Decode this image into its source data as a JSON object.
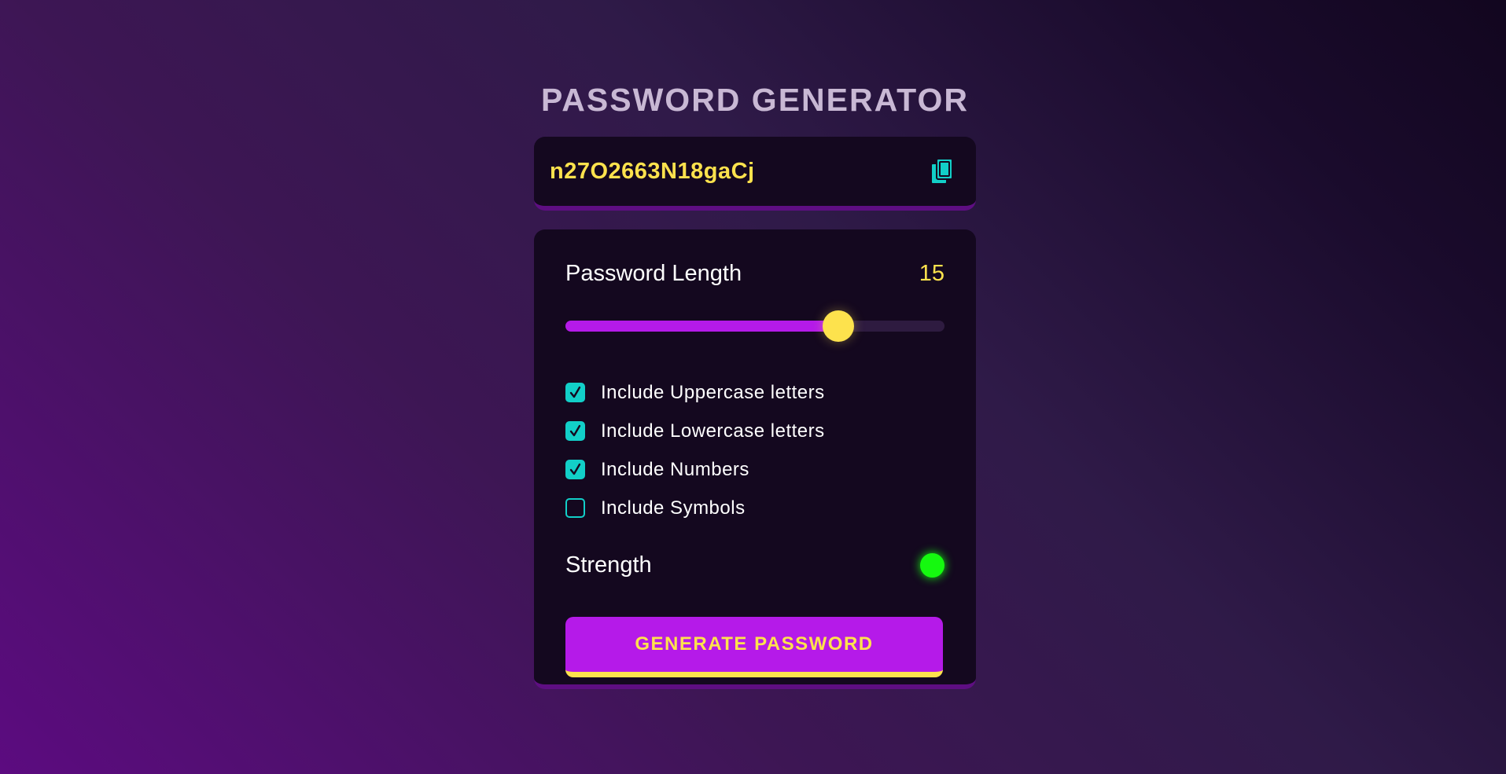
{
  "app": {
    "title": "PASSWORD GENERATOR"
  },
  "result": {
    "password": "n27O2663N18gaCj",
    "copy_icon": "copy-icon"
  },
  "length": {
    "label": "Password Length",
    "value": "15",
    "min": 4,
    "max": 20,
    "fill_fraction": 0.72
  },
  "options": [
    {
      "label": "Include Uppercase letters",
      "checked": true
    },
    {
      "label": "Include Lowercase letters",
      "checked": true
    },
    {
      "label": "Include Numbers",
      "checked": true
    },
    {
      "label": "Include Symbols",
      "checked": false
    }
  ],
  "strength": {
    "label": "Strength",
    "level": "strong",
    "color": "#15f90f"
  },
  "generate": {
    "label": "GENERATE PASSWORD"
  },
  "colors": {
    "accent_yellow": "#fde24d",
    "accent_purple": "#b51ae9",
    "accent_teal": "#12cfc8",
    "panel_bg": "#14081f"
  }
}
